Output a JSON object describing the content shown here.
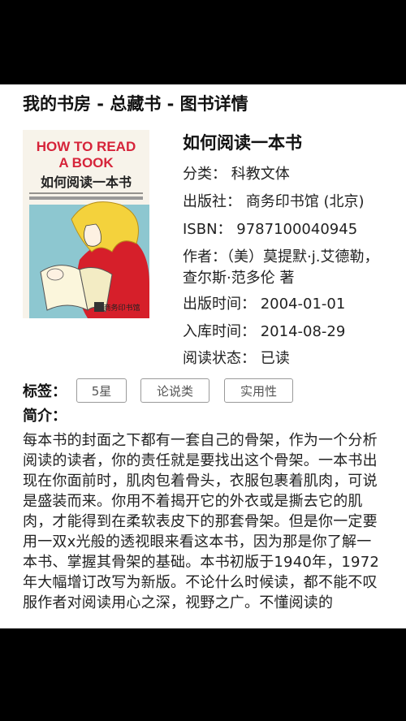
{
  "header": {
    "title": "我的书房 - 总藏书 - 图书详情"
  },
  "book": {
    "cover": {
      "title_line1": "HOW TO READ",
      "title_line2": "A BOOK",
      "subtitle": "如何阅读一本书",
      "seal": "商务印书馆"
    },
    "title": "如何阅读一本书",
    "category": "分类： 科教文体",
    "publisher": "出版社： 商务印书馆 (北京)",
    "isbn": "ISBN： 9787100040945",
    "author": "作者：（美）莫提默·j.艾德勒，查尔斯·范多伦 著",
    "publish_date": "出版时间： 2004-01-01",
    "stock_date": "入库时间： 2014-08-29",
    "read_status": "阅读状态： 已读"
  },
  "tags": {
    "label": "标签：",
    "items": [
      "5星",
      "论说类",
      "实用性"
    ]
  },
  "intro": {
    "label": "简介：",
    "text": "每本书的封面之下都有一套自己的骨架，作为一个分析阅读的读者，你的责任就是要找出这个骨架。一本书出现在你面前时，肌肉包着骨头，衣服包裹着肌肉，可说是盛装而来。你用不着揭开它的外衣或是撕去它的肌肉，才能得到在柔软表皮下的那套骨架。但是你一定要用一双x光般的透视眼来看这本书，因为那是你了解一本书、掌握其骨架的基础。本书初版于1940年，1972年大幅增订改写为新版。不论什么时候读，都不能不叹服作者对阅读用心之深，视野之广。不懂阅读的"
  },
  "colors": {
    "cover_bg": "#f7f3ea",
    "cover_title_red": "#d6243a",
    "cover_panel_blue": "#8dc7d0",
    "cover_red_dress": "#d61f2a",
    "cover_hair_yellow": "#f4d23c"
  }
}
